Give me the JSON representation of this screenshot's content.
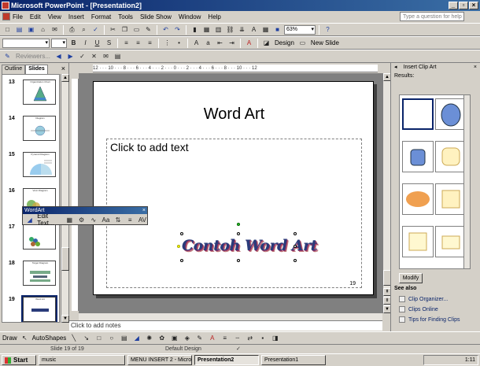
{
  "window": {
    "title": "Microsoft PowerPoint - [Presentation2]"
  },
  "menu": {
    "items": [
      "File",
      "Edit",
      "View",
      "Insert",
      "Format",
      "Tools",
      "Slide Show",
      "Window",
      "Help"
    ],
    "help_placeholder": "Type a question for help"
  },
  "formatting": {
    "zoom": "63%",
    "design_label": "Design",
    "new_slide_label": "New Slide"
  },
  "reviewing": {
    "reviewers_label": "Reviewers..."
  },
  "outline_panel": {
    "tabs": [
      "Outline",
      "Slides"
    ],
    "thumbnails": [
      {
        "number": "13",
        "title": "Organization Chart"
      },
      {
        "number": "14",
        "title": "Diagram"
      },
      {
        "number": "15",
        "title": "Pyramid Diagram"
      },
      {
        "number": "16",
        "title": "Venn Diagram"
      },
      {
        "number": "17",
        "title": ""
      },
      {
        "number": "18",
        "title": "Target Diagram"
      },
      {
        "number": "19",
        "title": "Word Art"
      }
    ]
  },
  "ruler": {
    "marks": "12 · · · 10 · · · 8 · · · 6 · · · 4 · · · 2 · · · 0 · · · 2 · · · 4 · · · 6 · · · 8 · · · 10 · · · 12"
  },
  "slide": {
    "title": "Word Art",
    "placeholder": "Click to add text",
    "wordart_text": "Contoh Word Art",
    "number": "19"
  },
  "notes": {
    "placeholder": "Click to add notes"
  },
  "wordart_toolbar": {
    "title": "WordArt",
    "edit_text_label": "Edit Text..."
  },
  "task_pane": {
    "title": "Insert Clip Art",
    "results_label": "Results:",
    "modify_label": "Modify",
    "see_also_label": "See also",
    "links": [
      "Clip Organizer...",
      "Clips Online",
      "Tips for Finding Clips"
    ]
  },
  "drawing": {
    "draw_label": "Draw",
    "autoshapes_label": "AutoShapes"
  },
  "status": {
    "slide_position": "Slide 19 of 19",
    "design": "Default Design"
  },
  "taskbar": {
    "start_label": "Start",
    "tasks": [
      "music",
      "MENU INSERT 2 - Micros...",
      "Presentation2",
      "Presentation1"
    ],
    "clock": "1:11"
  },
  "colors": {
    "title_bar": "#0a246a",
    "wordart_fill": "#2a3b7a",
    "wordart_shadow": "#a23060"
  }
}
